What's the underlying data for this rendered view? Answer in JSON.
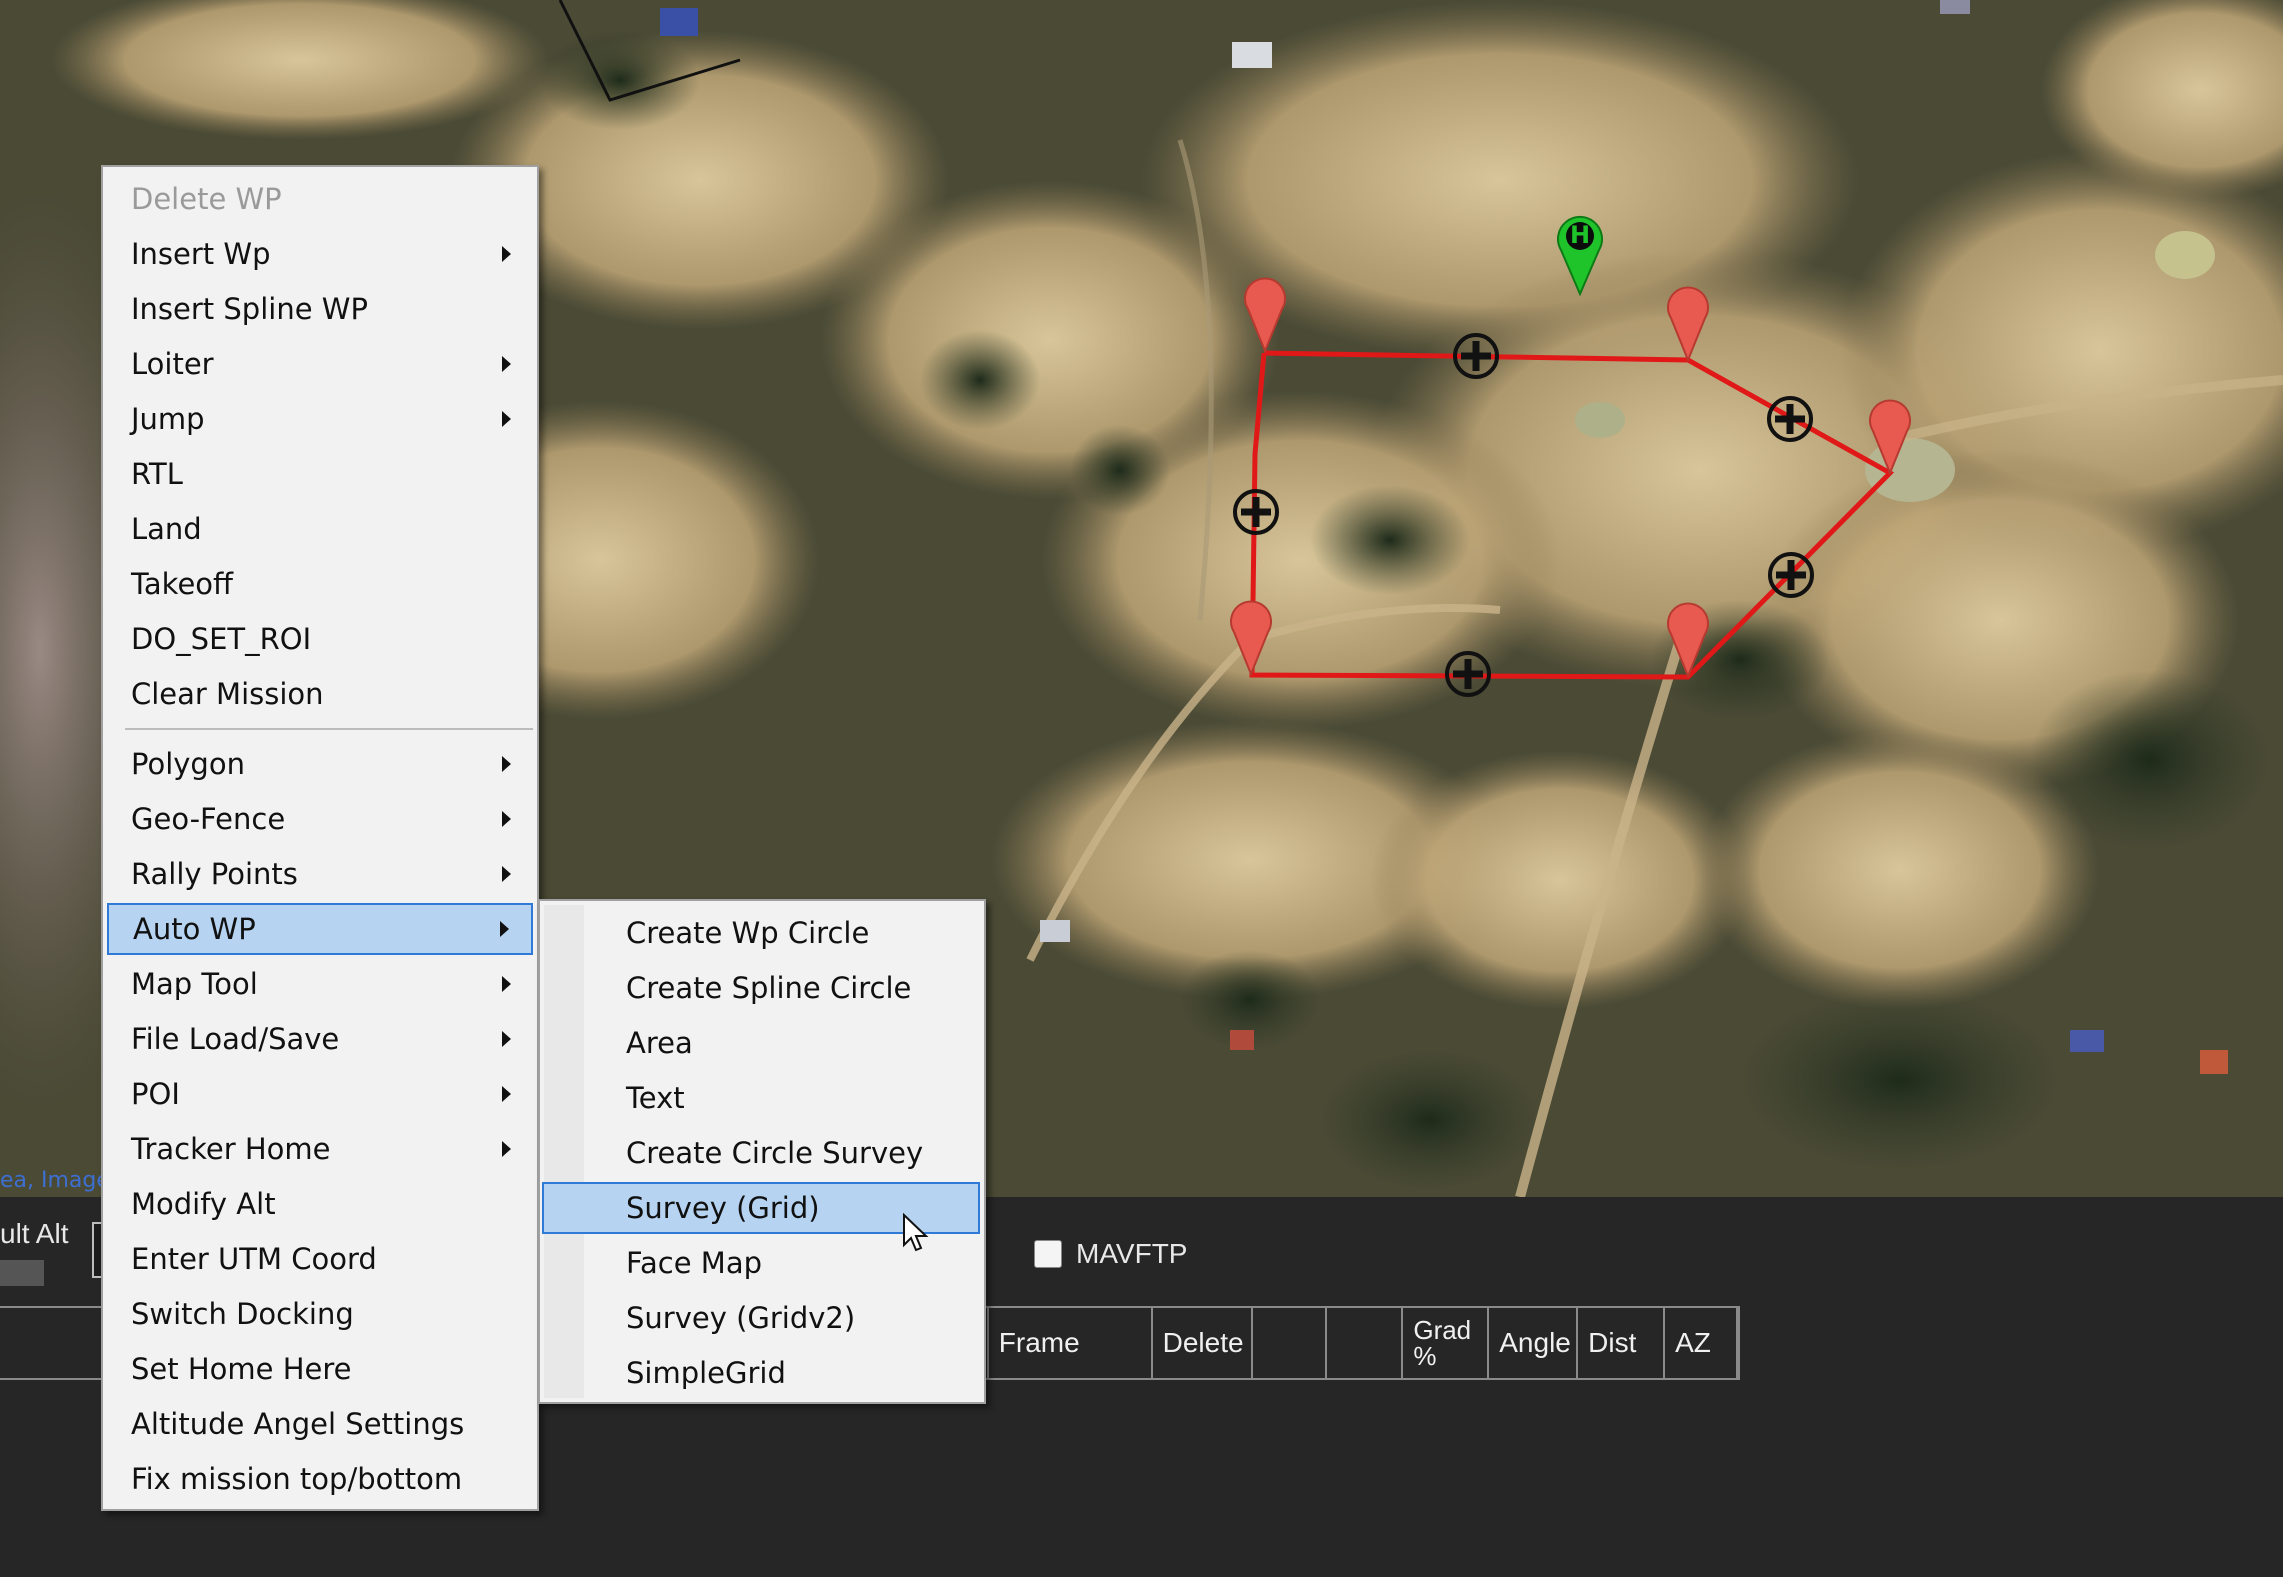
{
  "map": {
    "attribution": "ea, Image",
    "home_marker_label": "H",
    "route_color": "#e01818",
    "marker_color": "#e85a4f",
    "home_color": "#1fc42a"
  },
  "bottom": {
    "alt_label": "ult Alt",
    "mavftp_label": "MAVFTP",
    "columns": [
      "Frame",
      "Delete",
      "",
      "",
      "Grad\n%",
      "Angle",
      "Dist",
      "AZ"
    ]
  },
  "context_menu": {
    "items": [
      {
        "label": "Delete WP",
        "disabled": true,
        "submenu": false
      },
      {
        "label": "Insert Wp",
        "submenu": true
      },
      {
        "label": "Insert Spline WP",
        "submenu": false
      },
      {
        "label": "Loiter",
        "submenu": true
      },
      {
        "label": "Jump",
        "submenu": true
      },
      {
        "label": "RTL",
        "submenu": false
      },
      {
        "label": "Land",
        "submenu": false
      },
      {
        "label": "Takeoff",
        "submenu": false
      },
      {
        "label": "DO_SET_ROI",
        "submenu": false
      },
      {
        "label": "Clear Mission",
        "submenu": false
      },
      {
        "label": "Polygon",
        "submenu": true
      },
      {
        "label": "Geo-Fence",
        "submenu": true
      },
      {
        "label": "Rally Points",
        "submenu": true
      },
      {
        "label": "Auto WP",
        "submenu": true,
        "highlighted": true
      },
      {
        "label": "Map Tool",
        "submenu": true
      },
      {
        "label": "File Load/Save",
        "submenu": true
      },
      {
        "label": "POI",
        "submenu": true
      },
      {
        "label": "Tracker Home",
        "submenu": true
      },
      {
        "label": "Modify Alt",
        "submenu": false
      },
      {
        "label": "Enter UTM Coord",
        "submenu": false
      },
      {
        "label": "Switch Docking",
        "submenu": false
      },
      {
        "label": "Set Home Here",
        "submenu": false
      },
      {
        "label": "Altitude Angel Settings",
        "submenu": false
      },
      {
        "label": "Fix mission top/bottom",
        "submenu": false
      }
    ]
  },
  "auto_wp_submenu": {
    "items": [
      {
        "label": "Create Wp Circle"
      },
      {
        "label": "Create Spline Circle"
      },
      {
        "label": "Area"
      },
      {
        "label": "Text"
      },
      {
        "label": "Create Circle Survey"
      },
      {
        "label": "Survey (Grid)",
        "highlighted": true
      },
      {
        "label": "Face Map"
      },
      {
        "label": "Survey (Gridv2)"
      },
      {
        "label": "SimpleGrid"
      }
    ]
  }
}
